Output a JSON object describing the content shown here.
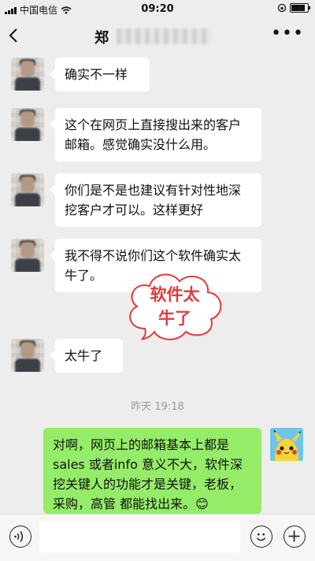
{
  "status": {
    "carrier": "中国电信",
    "time": "09:20",
    "battery_percent": 90
  },
  "nav": {
    "back_icon": "chevron-left-icon",
    "title_visible": "郑",
    "more_icon": "more-dots-icon"
  },
  "messages": [
    {
      "side": "left",
      "text": "确实不一样"
    },
    {
      "side": "left",
      "text": "这个在网页上直接搜出来的客户邮箱。感觉确实没什么用。"
    },
    {
      "side": "left",
      "text": "你们是不是也建议有针对性地深挖客户才可以。这样更好"
    },
    {
      "side": "left",
      "text": "我不得不说你们这个软件确实太牛了。"
    },
    {
      "side": "left",
      "text": "太牛了"
    },
    {
      "side": "right",
      "text": "对啊，网页上的邮箱基本上都是sales 或者info 意义不大，软件深挖关键人的功能才是关键，老板，采购，高管 都能找出来。😊"
    }
  ],
  "timestamp": "昨天 19:18",
  "sticker": {
    "line1": "软件太",
    "line2": "牛了"
  },
  "input_bar": {
    "voice_icon": "voice-icon",
    "emoji_icon": "emoji-icon",
    "plus_icon": "plus-icon"
  },
  "colors": {
    "background": "#ededed",
    "sent_bubble": "#95ec69",
    "received_bubble": "#ffffff",
    "sticker_text": "#e03b3b"
  }
}
